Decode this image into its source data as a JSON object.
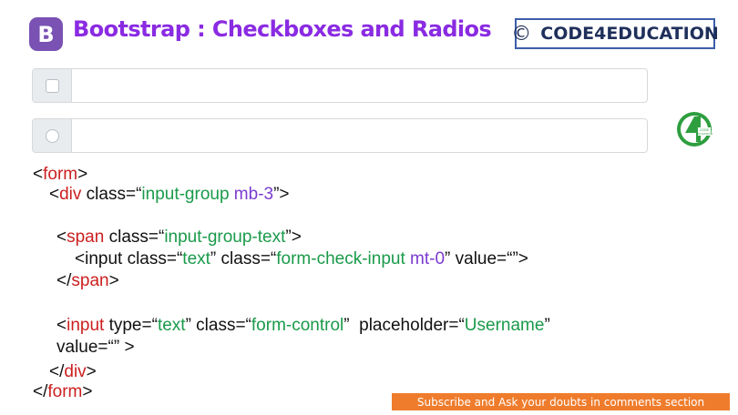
{
  "header": {
    "logo_letter": "B",
    "title": "Bootstrap : Checkboxes and Radios",
    "brand_symbol": "©",
    "brand_name": "CODE4EDUCATION"
  },
  "badge": {
    "icon": "code4education-logo-icon",
    "color": "#2e9e3f"
  },
  "demo": [
    {
      "type": "checkbox",
      "value": ""
    },
    {
      "type": "radio",
      "value": ""
    }
  ],
  "code": {
    "l1_open": "<",
    "l1_tag": "form",
    "l1_close": ">",
    "l2_open": "<",
    "l2_tag": "div",
    "l2_attr": " class=“",
    "l2_val1": "input-group",
    "l2_val2": " mb-3",
    "l2_end": "”>",
    "l3_open": "<",
    "l3_tag": "span",
    "l3_attr": " class=“",
    "l3_val": "input-group-text",
    "l3_end": "”>",
    "l4_a": "<input class=“",
    "l4_v1": "text",
    "l4_b": "” class=“",
    "l4_v2": "form-check-input",
    "l4_v3": " mt-0",
    "l4_c": "” value=“”>",
    "l5_open": "</",
    "l5_tag": "span",
    "l5_close": ">",
    "l6_open": "<",
    "l6_tag": "input",
    "l6_a": " type=“",
    "l6_v1": "text",
    "l6_b": "” class=“",
    "l6_v2": "form-control",
    "l6_c": "”  placeholder=“",
    "l6_v3": "Username",
    "l6_d": "”",
    "l7": "value=“” >",
    "l8_open": "</",
    "l8_tag": "div",
    "l8_close": ">",
    "l9_open": "</",
    "l9_tag": "form",
    "l9_close": ">"
  },
  "banner_text": "Subscribe and Ask your doubts in comments section",
  "colors": {
    "title": "#8a2be2",
    "bootstrap": "#7952b3",
    "tag": "#cc1f1f",
    "string": "#1a9a4a",
    "class_accent": "#7a3bd1",
    "banner": "#ef7c2c",
    "brand_border": "#3b5ea8"
  }
}
